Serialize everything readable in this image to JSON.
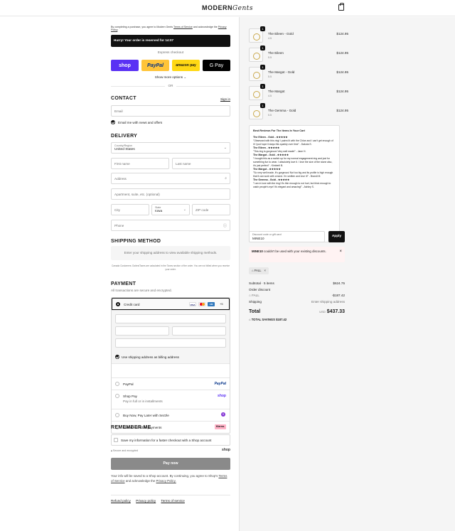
{
  "header": {
    "brand_bold": "MODERN",
    "brand_script": "Gents",
    "cart_icon": "shopping-bag-icon"
  },
  "terms": {
    "prefix": "By completing a purchase, you agree to Modern Gents",
    "terms_link": "Terms of Service",
    "mid": "and acknowledge the",
    "privacy_link": "Privacy Policy"
  },
  "banner": {
    "text": "Hurry! Your order is reserved for 14:07"
  },
  "express": {
    "label": "Express checkout",
    "shop": "shop",
    "paypal": "PayPal",
    "amazon": "amazon pay",
    "gpay": "G Pay",
    "more": "Show more options"
  },
  "divider": {
    "or": "OR"
  },
  "contact": {
    "title": "CONTACT",
    "sign_in": "Sign in",
    "email_placeholder": "Email",
    "news_label": "Email me with news and offers"
  },
  "delivery": {
    "title": "DELIVERY",
    "country_label": "Country/Region",
    "country_value": "United States",
    "first_name": "First name",
    "last_name": "Last name",
    "address": "Address",
    "apartment": "Apartment, suite, etc. (optional)",
    "city": "City",
    "state_label": "State",
    "state_value": "Iowa",
    "zip": "ZIP code",
    "phone": "Phone"
  },
  "shipping_method": {
    "title": "SHIPPING METHOD",
    "empty": "Enter your shipping address to view available shipping methods.",
    "note": "Canada Customers: Duties/Taxes are calculated in the Taxes section of the order. You are not billed when you receive your order."
  },
  "payment": {
    "title": "PAYMENT",
    "subtitle": "All transactions are secure and encrypted.",
    "credit_card": "Credit card",
    "more_brands": "+5",
    "billing_same": "Use shipping address as billing address",
    "options": [
      {
        "label": "PayPal",
        "sub": "",
        "logo": "PayPal"
      },
      {
        "label": "Shop Pay",
        "sub": "Pay in full or in installments",
        "logo": "shop"
      },
      {
        "label": "Buy Now, Pay Later with Sezzle",
        "sub": "",
        "logo": "S"
      },
      {
        "label": "Klarna - Flexible payments",
        "sub": "",
        "logo": "Klarna."
      }
    ]
  },
  "remember": {
    "title": "REMEMBER ME",
    "save_label": "Save my information for a faster checkout with a Shop account",
    "secure": "Secure and encrypted",
    "shop_logo": "shop"
  },
  "paynow": {
    "label": "Pay now"
  },
  "footer_note": {
    "text1": "Your info will be saved to a Shop account. By continuing, you agree to Shop's",
    "terms": "Terms of Service",
    "text2": "and acknowledge the",
    "privacy": "Privacy Policy."
  },
  "footer_links": [
    "Refund policy",
    "Privacy policy",
    "Terms of service"
  ],
  "cart": {
    "items": [
      {
        "name": "The Eileen - Gold",
        "size": "4.5",
        "qty": "1",
        "price": "$124.95"
      },
      {
        "name": "The Eileen",
        "size": "5.5",
        "qty": "1",
        "price": "$124.95"
      },
      {
        "name": "The Margot - Gold",
        "size": "5.5",
        "qty": "1",
        "price": "$124.95"
      },
      {
        "name": "The Margot",
        "size": "4.5",
        "qty": "1",
        "price": "$124.95"
      },
      {
        "name": "The Gemma - Gold",
        "size": "5.5",
        "qty": "1",
        "price": "$124.95"
      }
    ]
  },
  "reviews": {
    "title": "Best Reviews For The Items In Your Cart",
    "entries": [
      {
        "product": "The Eileen - Gold - ★★★★★",
        "text": "\"Obsessed with this ring! I paired it with the Chloe and I can't get enough of it! I just hope it stays this sparkly over time\" - Dakota S."
      },
      {
        "product": "The Eileen - ★★★★★",
        "text": "\"This ring is gorgeous! Very well made!\" - Jane H."
      },
      {
        "product": "The Margot - Gold - ★★★★★",
        "text": "\"I bought this as a switch up for my normal engagement ring and just for something fun to wear. I absolutely love it. I love the size of the stone also, it's just perfect\" - Kimberli B."
      },
      {
        "product": "The Margot - ★★★★★",
        "text": "\"So very well made, it's gorgeous! Not too big and its profile is high enough that it can work with a band. I'm smitten and love it!\" - Brandi M."
      },
      {
        "product": "The Gemma - Gold - ★★★★★",
        "text": "\"I am in love with the ring! It's thin enough to not hurt, but thick enough to catch people's eye! It's elegant and amazing!\" - Ashley S."
      }
    ]
  },
  "discount": {
    "label": "Discount code or gift card",
    "value": "MINE10",
    "apply": "Apply",
    "error_code": "MINE10",
    "error_text": "couldn't be used with your existing discounts.",
    "tag": "FALL"
  },
  "summary": {
    "subtotal_label": "Subtotal · 5 items",
    "subtotal": "$624.75",
    "order_discount_label": "Order discount",
    "fall_label": "FALL",
    "fall_value": "-$187.42",
    "shipping_label": "Shipping",
    "shipping_value": "Enter shipping address",
    "total_label": "Total",
    "currency": "USD",
    "total": "$437.33",
    "savings_label": "TOTAL SAVINGS",
    "savings": "$187.42"
  },
  "colors": {
    "shop": "#5a31f4",
    "paypal": "#ffc439",
    "amazon": "#ffd814",
    "accent": "#111111"
  }
}
